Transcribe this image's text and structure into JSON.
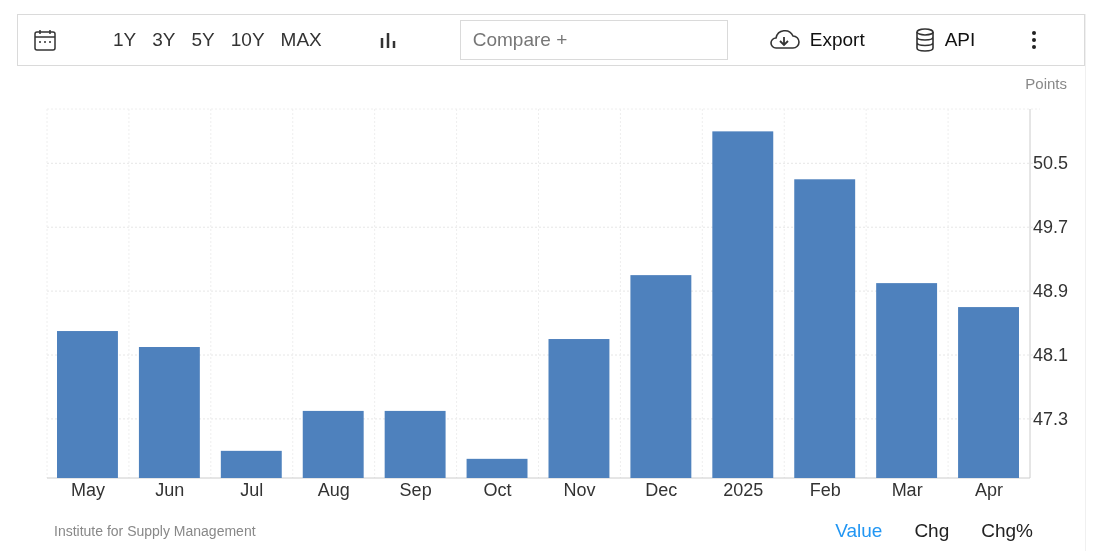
{
  "toolbar": {
    "ranges": [
      {
        "label": "1Y",
        "selected": false
      },
      {
        "label": "3Y",
        "selected": false
      },
      {
        "label": "5Y",
        "selected": false
      },
      {
        "label": "10Y",
        "selected": false
      },
      {
        "label": "MAX",
        "selected": false
      }
    ],
    "compare": {
      "placeholder": "Compare +"
    },
    "export": "Export",
    "api": "API"
  },
  "chart_data": {
    "type": "bar",
    "ylabel": "Points",
    "categories": [
      "May",
      "Jun",
      "Jul",
      "Aug",
      "Sep",
      "Oct",
      "Nov",
      "Dec",
      "2025",
      "Feb",
      "Mar",
      "Apr"
    ],
    "grid": true,
    "series": [
      {
        "color": "#4e81bd",
        "values": [
          48.4,
          48.2,
          46.9,
          47.4,
          47.4,
          46.8,
          48.3,
          49.1,
          50.9,
          50.3,
          49.0,
          48.7
        ]
      }
    ],
    "ylim": [
      46.56,
      51.18
    ],
    "yticks": [
      47.3,
      48.1,
      48.9,
      49.7,
      50.5
    ]
  },
  "source": "Institute for Supply Management",
  "views": [
    {
      "label": "Value",
      "selected": true
    },
    {
      "label": "Chg",
      "selected": false
    },
    {
      "label": "Chg%",
      "selected": false
    }
  ]
}
